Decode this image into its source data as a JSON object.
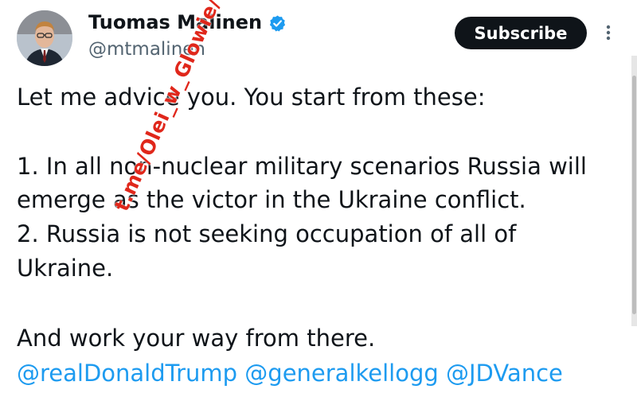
{
  "author": {
    "name": "Tuomas Malinen",
    "handle": "@mtmalinen",
    "verified": true,
    "verified_icon": "verified-badge-icon",
    "verified_color": "#1d9bf0"
  },
  "header": {
    "subscribe_label": "Subscribe",
    "more_icon": "more-vertical-icon"
  },
  "tweet": {
    "lines": [
      "Let me advice you. You start from these:",
      "1. In all non-nuclear military scenarios Russia will",
      "emerge as the victor in the Ukraine conflict.",
      "2. Russia is not seeking occupation of all of",
      "Ukraine.",
      "And work your way from there."
    ],
    "mentions": [
      "@realDonaldTrump",
      "@generalkellogg",
      "@JDVance"
    ]
  },
  "watermark": {
    "text": "t.me/Olei_w_Glowie/",
    "color": "#e0271b"
  },
  "colors": {
    "text": "#0f1419",
    "secondary": "#536471",
    "link": "#1d9bf0",
    "button_bg": "#0f1419"
  }
}
